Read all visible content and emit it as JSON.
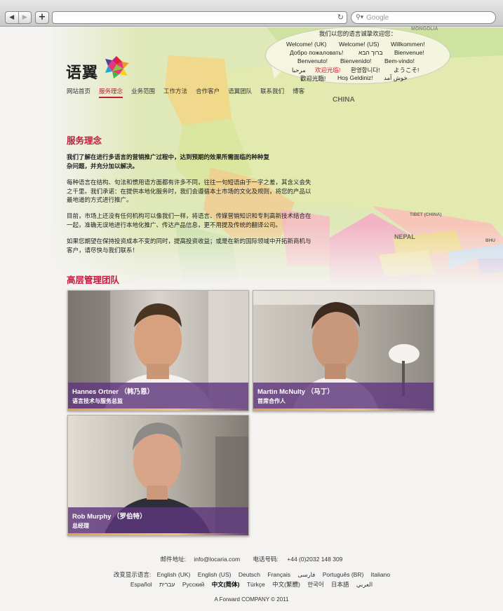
{
  "browser": {
    "search_placeholder": "Google",
    "back_icon": "back-arrow-icon",
    "forward_icon": "forward-arrow-icon",
    "new_tab_label": "+"
  },
  "bubble": {
    "title": "我们以您的语言诚挚欢迎您：",
    "greetings": [
      "Welcome! (UK)",
      "Welcome! (US)",
      "Willkommen!",
      "Добро пожаловать!",
      "ברוך הבא",
      "Bienvenue!",
      "Benvenuto!",
      "Bienvenido!",
      "Bem-vindo!",
      "مرحبا",
      "欢迎光临!",
      "환영합니다!",
      "ようこそ!",
      "歡迎光臨!",
      "Hoş Geldiniz!",
      "خوش آمد"
    ]
  },
  "map_labels": {
    "china": "CHINA",
    "nepal": "NEPAL",
    "tibet": "TIBET (CHINA)",
    "mongolia": "MONGOLIA",
    "bhutan": "BHU"
  },
  "logo": {
    "text": "语翼"
  },
  "nav": [
    {
      "label": "网站首页"
    },
    {
      "label": "服务理念"
    },
    {
      "label": "业务范围"
    },
    {
      "label": "工作方法"
    },
    {
      "label": "合作客户"
    },
    {
      "label": "语翼团队"
    },
    {
      "label": "联系我们"
    },
    {
      "label": "博客"
    }
  ],
  "section1": {
    "title": "服务理念",
    "p1": "我们了解在进行多语言的营销推广过程中，达到预期的效果所需面临的种种复杂问题，并充分加以解决。",
    "p2": "每种语言在结构、句法和惯用语方面都有许多不同，往往一句短语由于一字之差，其含义会失之千里。我们承诺：在提供本地化服务时，我们会遵循本土市场的文化及规则，将您的产品以最地道的方式进行推广。",
    "p3": "目前，市场上还没有任何机构可以像我们一样，将语言、传媒营销知识和专利高新技术结合在一起，准确无误地进行本地化推广、传达产品信息，更不用提及传统的翻译公司。",
    "p4": "如果您期望在保持投资成本不变的同时，提高投资收益；或是在新的国际领域中开拓新商机与客户，请尽快与我们联系！"
  },
  "section2": {
    "title": "高层管理团队",
    "members": [
      {
        "name": "Hannes Ortner （韩乃恩）",
        "role": "语言技术与服务总监"
      },
      {
        "name": "Martin McNulty （马丁）",
        "role": "首席合作人"
      },
      {
        "name": "Rob Murphy （罗伯特）",
        "role": "总经理"
      }
    ]
  },
  "footer": {
    "address_label": "邮件地址:",
    "email": "info@locaria.com",
    "phone_label": "电话号码:",
    "phone": "+44 (0)2032 148 309",
    "lang_label": "改变显示语言:",
    "languages_row1": [
      "English (UK)",
      "English (US)",
      "Deutsch",
      "Français",
      "فارسی",
      "Português (BR)",
      "Italiano"
    ],
    "languages_row2": [
      "Español",
      "עברית",
      "Русский",
      "中文(简体)",
      "Türkçe",
      "中文(繁體)",
      "한국어",
      "日本語",
      "العربي"
    ],
    "copyright": "A Forward COMPANY © 2011"
  }
}
